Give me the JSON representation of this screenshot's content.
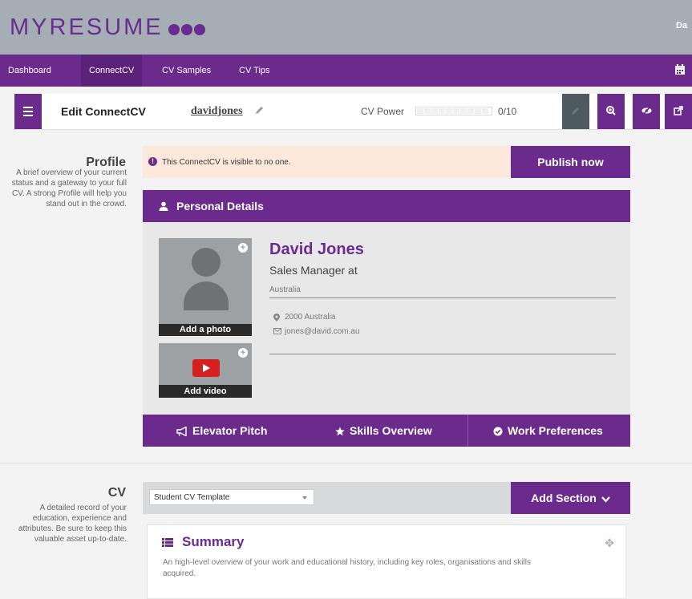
{
  "header": {
    "logo_text": "MYRESUME",
    "user_label": "Da"
  },
  "nav": {
    "items": [
      "Dashboard",
      "ConnectCV",
      "CV Samples",
      "CV Tips"
    ],
    "active": "ConnectCV"
  },
  "toolbar": {
    "title": "Edit ConnectCV",
    "username": "davidjones",
    "power_label": "CV Power",
    "power_score": "0/10",
    "power_value": 0
  },
  "profile_side": {
    "heading": "Profile",
    "description": "A brief overview of your current status and a gateway to your full CV. A strong Profile will help you stand out in the crowd."
  },
  "alert": {
    "text": "This ConnectCV is visible to no one.",
    "publish_label": "Publish now"
  },
  "personal": {
    "heading": "Personal Details",
    "name": "David Jones",
    "job_title": "Sales Manager at",
    "country": "Australia",
    "location": "2000 Australia",
    "email": "jones@david.com.au",
    "add_photo": "Add a photo",
    "add_video": "Add video"
  },
  "tabs": [
    "Elevator Pitch",
    "Skills Overview",
    "Work Preferences"
  ],
  "cv_side": {
    "heading": "CV",
    "description": "A detailed record of your education, experience and attributes. Be sure to keep this valuable asset up-to-date."
  },
  "cv": {
    "template_value": "Student CV Template",
    "add_section_label": "Add Section"
  },
  "summary": {
    "title": "Summary",
    "description": "An high-level overview of your work and educational history, including key roles, organisations and skills acquired."
  },
  "colors": {
    "brand_purple": "#6a2b8d",
    "header_grey": "#a5aeb4",
    "alert_bg": "#fde9dc",
    "youtube_red": "#d61f1f"
  }
}
